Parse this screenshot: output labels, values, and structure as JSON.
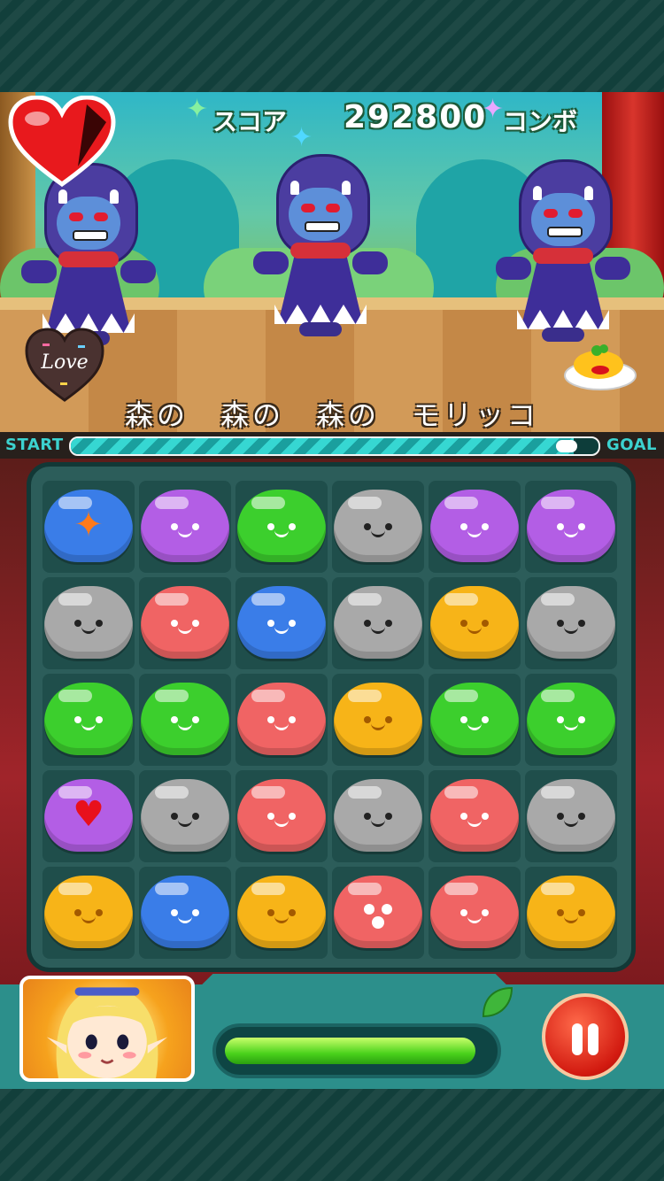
{
  "hud": {
    "score_label": "スコア",
    "score_value": "292800",
    "combo_label": "コンボ",
    "love_badge_text": "Love"
  },
  "song": {
    "title": "森の　森の　森の　モリッコ"
  },
  "progress": {
    "start_label": "START",
    "goal_label": "GOAL",
    "fraction": 0.96
  },
  "hp": {
    "fraction": 0.95
  },
  "board": {
    "rows": [
      [
        "blue-star",
        "purple",
        "green",
        "gray",
        "purple",
        "purple"
      ],
      [
        "gray",
        "red",
        "blue",
        "gray",
        "yellow",
        "gray"
      ],
      [
        "green",
        "green",
        "red",
        "yellow",
        "green",
        "green"
      ],
      [
        "purple-heart",
        "gray",
        "red",
        "gray",
        "red",
        "gray"
      ],
      [
        "yellow",
        "blue",
        "yellow",
        "red-surprised",
        "red",
        "yellow"
      ]
    ]
  },
  "colors": {
    "accent_teal": "#3cd2cf",
    "pause_red": "#d21a10",
    "hp_green": "#4ad21c"
  },
  "icons": [
    "heart-life-icon",
    "love-badge-icon",
    "omelet-icon",
    "pause-icon",
    "leaf-icon",
    "star-sparkle-icon"
  ]
}
